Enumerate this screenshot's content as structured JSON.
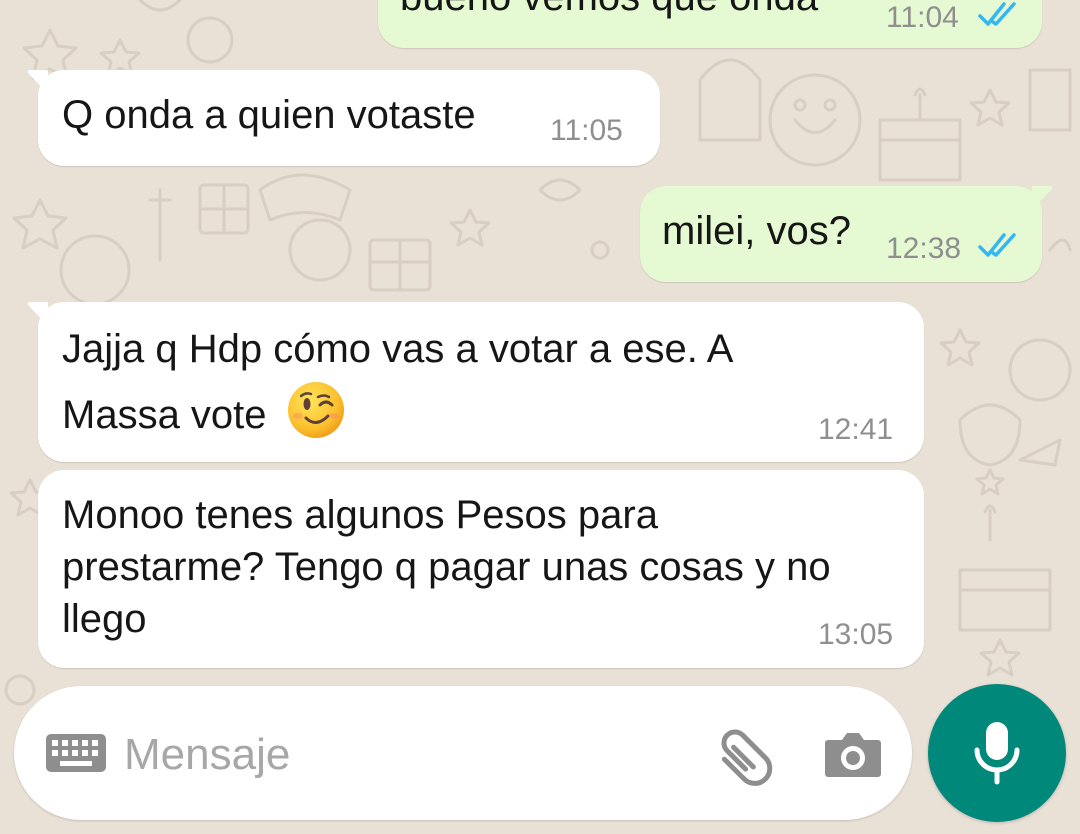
{
  "chat": {
    "messages": [
      {
        "direction": "outgoing",
        "text": "bueno vemos que onda",
        "time": "11:04",
        "status": "read"
      },
      {
        "direction": "incoming",
        "text": "Q onda a quien votaste",
        "time": "11:05"
      },
      {
        "direction": "outgoing",
        "text": "milei, vos?",
        "time": "12:38",
        "status": "read"
      },
      {
        "direction": "incoming",
        "lines": [
          "Jajja q Hdp cómo vas a votar a ese. A",
          "Massa vote"
        ],
        "emoji": "winking-face-emoji",
        "time": "12:41"
      },
      {
        "direction": "incoming",
        "lines": [
          "Monoo tenes algunos Pesos para",
          "prestarme? Tengo q pagar unas cosas y no",
          "llego"
        ],
        "time": "13:05"
      }
    ]
  },
  "composer": {
    "placeholder": "Mensaje",
    "icons": [
      "keyboard-icon",
      "attach-icon",
      "camera-icon",
      "mic-icon"
    ]
  },
  "colors": {
    "background": "#e9e0d6",
    "incoming_bubble": "#ffffff",
    "outgoing_bubble": "#e5f9d2",
    "read_ticks": "#34b7f1",
    "accent": "#00897b"
  }
}
